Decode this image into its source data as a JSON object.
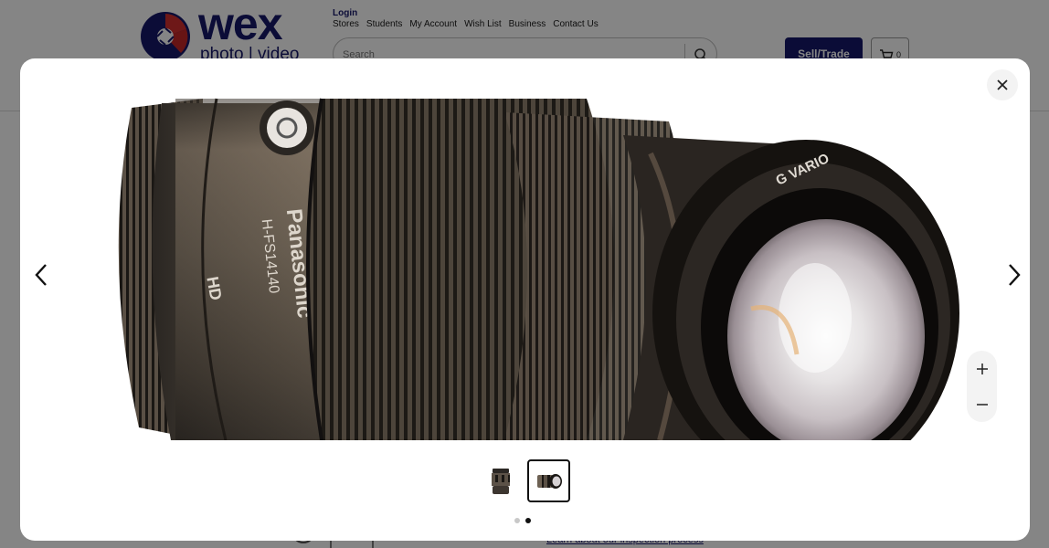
{
  "site": {
    "logo_word": "wex",
    "logo_sub": "photo | video",
    "login": "Login",
    "nav": [
      "Stores",
      "Students",
      "My Account",
      "Wish List",
      "Business",
      "Contact Us"
    ],
    "search_placeholder": "Search",
    "sell_trade": "Sell/Trade",
    "cart_count": "0",
    "footer_link": "Learn about our inspection process"
  },
  "lens_markings": {
    "brand": "Panasonic",
    "model": "H-FS14140",
    "badge": "HD",
    "ring": "G VARIO"
  },
  "gallery": {
    "thumbnail_count": 2,
    "active_index": 2
  },
  "icons": {
    "close": "close-icon",
    "prev": "chevron-left-icon",
    "next": "chevron-right-icon",
    "zoom_in": "plus-icon",
    "zoom_out": "minus-icon",
    "search": "search-icon",
    "cart": "cart-icon"
  },
  "colors": {
    "brand_navy": "#16176a",
    "brand_red": "#d32f2f",
    "overlay": "rgba(0,0,0,0.48)"
  }
}
